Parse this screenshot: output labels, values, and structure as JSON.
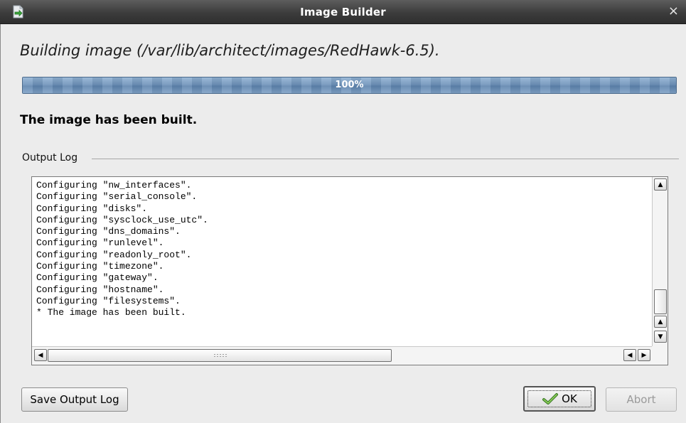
{
  "window": {
    "title": "Image Builder",
    "close_glyph": "×",
    "app_icon": "document-arrow-icon"
  },
  "main": {
    "heading": "Building image (/var/lib/architect/images/RedHawk-6.5).",
    "progress": {
      "value": 1.0,
      "label": "100%"
    },
    "status": "The image has been built."
  },
  "output_log": {
    "label": "Output Log",
    "lines": [
      "Configuring \"nw_interfaces\".",
      "Configuring \"serial_console\".",
      "Configuring \"disks\".",
      "Configuring \"sysclock_use_utc\".",
      "Configuring \"dns_domains\".",
      "Configuring \"runlevel\".",
      "Configuring \"readonly_root\".",
      "Configuring \"timezone\".",
      "Configuring \"gateway\".",
      "Configuring \"hostname\".",
      "Configuring \"filesystems\".",
      "* The image has been built."
    ]
  },
  "buttons": {
    "save_log": "Save Output Log",
    "ok": "OK",
    "abort": "Abort"
  },
  "colors": {
    "titlebar": "#3c3c3c",
    "progress_fill": "#6f93ba",
    "window_bg": "#ececec"
  }
}
